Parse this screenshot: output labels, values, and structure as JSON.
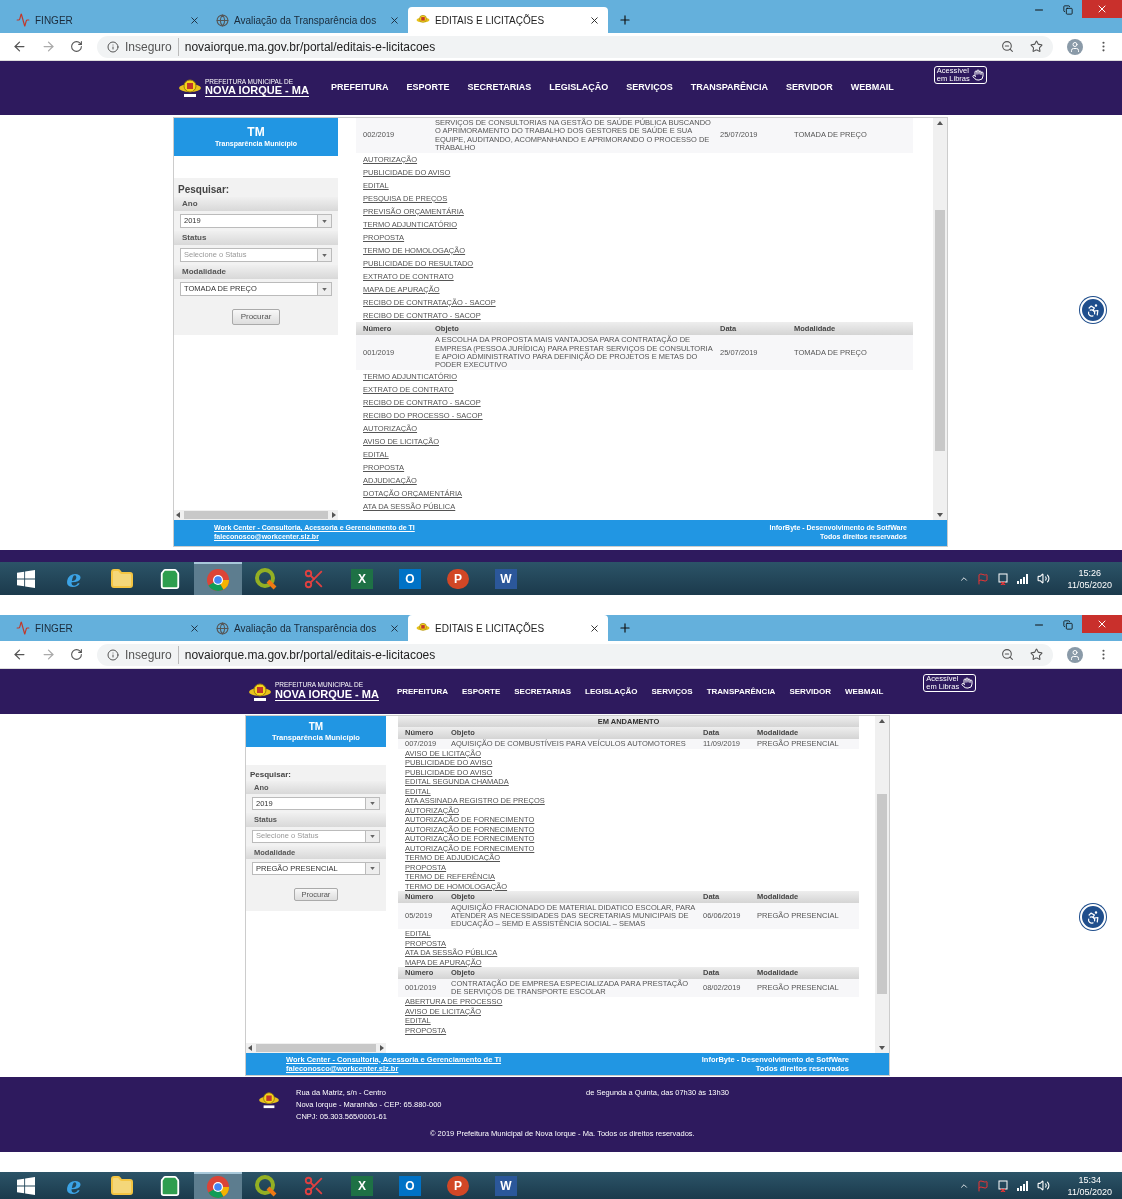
{
  "shots": [
    {
      "browser": {
        "tabs": [
          {
            "title": "FINGER",
            "kind": "finger",
            "selected": false
          },
          {
            "title": "Avaliação da Transparência dos",
            "kind": "globe",
            "selected": false
          },
          {
            "title": "EDITAIS E LICITAÇÕES",
            "kind": "crest",
            "selected": true
          }
        ],
        "security": "Inseguro",
        "url": "novaiorque.ma.gov.br/portal/editais-e-licitacoes"
      },
      "site_header": {
        "logo_small": "PREFEITURA MUNICIPAL DE",
        "logo_name": "NOVA IORQUE - MA",
        "nav": [
          "PREFEITURA",
          "ESPORTE",
          "SECRETARIAS",
          "LEGISLAÇÃO",
          "SERVIÇOS",
          "TRANSPARÊNCIA",
          "SERVIDOR",
          "WEBMAIL"
        ],
        "libras": [
          "Acessível",
          "em Libras"
        ]
      },
      "panel": {
        "brand_title": "TM",
        "brand_subtitle": "Transparência Município",
        "search_label": "Pesquisar:",
        "filters": [
          {
            "label": "Ano",
            "value": "2019"
          },
          {
            "label": "Status",
            "placeholder": "Selecione o Status"
          },
          {
            "label": "Modalidade",
            "value": "TOMADA DE PREÇO"
          }
        ],
        "button": "Procurar"
      },
      "list": {
        "groups": [
          {
            "numero": "002/2019",
            "objeto": "SERVIÇOS DE CONSULTORIAS NA GESTÃO DE SAÚDE PÚBLICA BUSCANDO O APRIMORAMENTO DO TRABALHO DOS GESTORES DE SAÚDE E SUA EQUIPE, AUDITANDO, ACOMPANHANDO E APRIMORANDO O PROCESSO DE TRABALHO",
            "data": "25/07/2019",
            "modalidade": "TOMADA DE PREÇO",
            "documents": [
              "AUTORIZAÇÃO",
              "PUBLICIDADE DO AVISO",
              "EDITAL",
              "PESQUISA DE PREÇOS",
              "PREVISÃO ORÇAMENTÁRIA",
              "TERMO ADJUNTICATÓRIO",
              "PROPOSTA",
              "TERMO DE HOMOLOGAÇÃO",
              "PUBLICIDADE DO RESULTADO",
              "EXTRATO DE CONTRATO",
              "MAPA DE APURAÇÃO",
              "RECIBO DE CONTRATAÇÃO - SACOP",
              "RECIBO DE CONTRATO - SACOP"
            ]
          },
          {
            "columns": [
              "Número",
              "Objeto",
              "Data",
              "Modalidade"
            ],
            "numero": "001/2019",
            "objeto": "A ESCOLHA DA PROPOSTA MAIS VANTAJOSA PARA CONTRATAÇÃO DE EMPRESA (PESSOA JURÍDICA) PARA PRESTAR SERVIÇOS DE CONSULTORIA E APOIO ADMINISTRATIVO PARA DEFINIÇÃO DE PROJETOS E METAS DO PODER EXECUTIVO",
            "data": "25/07/2019",
            "modalidade": "TOMADA DE PREÇO",
            "documents": [
              "TERMO ADJUNTICATÓRIO",
              "EXTRATO DE CONTRATO",
              "RECIBO DE CONTRATO - SACOP",
              "RECIBO DO PROCESSO - SACOP",
              "AUTORIZAÇÃO",
              "AVISO DE LICITAÇÃO",
              "EDITAL",
              "PROPOSTA",
              "ADJUDICAÇÃO",
              "DOTAÇÃO ORÇAMENTÁRIA",
              "ATA DA SESSÃO PÚBLICA"
            ]
          }
        ]
      },
      "frame_footer": {
        "links": [
          "Work Center - Consultoria, Acessoria e Gerenciamento de TI",
          "faleconosco@workcenter.slz.br"
        ],
        "credits": [
          "InforByte - Desenvolvimento de SotfWare",
          "Todos direitos reservados"
        ]
      },
      "taskbar": {
        "apps": [
          {
            "kind": "ie",
            "glyph": "e",
            "selected": false
          },
          {
            "kind": "folder",
            "selected": false
          },
          {
            "kind": "store",
            "selected": false
          },
          {
            "kind": "chrome",
            "selected": true
          },
          {
            "kind": "qgis",
            "selected": false
          },
          {
            "kind": "snip",
            "selected": false
          },
          {
            "kind": "excel",
            "glyph": "X",
            "selected": false
          },
          {
            "kind": "outlook",
            "glyph": "O",
            "selected": false
          },
          {
            "kind": "powerpoint",
            "glyph": "P",
            "selected": false
          },
          {
            "kind": "word",
            "glyph": "W",
            "selected": false
          }
        ],
        "time": "15:26",
        "date": "11/05/2020"
      }
    },
    {
      "browser": {
        "tabs": [
          {
            "title": "FINGER",
            "kind": "finger",
            "selected": false
          },
          {
            "title": "Avaliação da Transparência dos",
            "kind": "globe",
            "selected": false
          },
          {
            "title": "EDITAIS E LICITAÇÕES",
            "kind": "crest",
            "selected": true
          }
        ],
        "security": "Inseguro",
        "url": "novaiorque.ma.gov.br/portal/editais-e-licitacoes"
      },
      "site_header": {
        "logo_small": "PREFEITURA MUNICIPAL DE",
        "logo_name": "NOVA IORQUE - MA",
        "nav": [
          "PREFEITURA",
          "ESPORTE",
          "SECRETARIAS",
          "LEGISLAÇÃO",
          "SERVIÇOS",
          "TRANSPARÊNCIA",
          "SERVIDOR",
          "WEBMAIL"
        ],
        "libras": [
          "Acessível",
          "em Libras"
        ]
      },
      "panel": {
        "brand_title": "TM",
        "brand_subtitle": "Transparência Município",
        "search_label": "Pesquisar:",
        "filters": [
          {
            "label": "Ano",
            "value": "2019"
          },
          {
            "label": "Status",
            "placeholder": "Selecione o Status"
          },
          {
            "label": "Modalidade",
            "value": "PREGÃO PRESENCIAL"
          }
        ],
        "button": "Procurar"
      },
      "list": {
        "heading": "EM ANDAMENTO",
        "groups": [
          {
            "columns": [
              "Número",
              "Objeto",
              "Data",
              "Modalidade"
            ],
            "numero": "007/2019",
            "objeto": "AQUISIÇÃO DE COMBUSTÍVEIS PARA VEÍCULOS AUTOMOTORES",
            "data": "11/09/2019",
            "modalidade": "PREGÃO PRESENCIAL",
            "documents": [
              "AVISO DE LICITAÇÃO",
              "PUBLICIDADE DO AVISO",
              "PUBLICIDADE DO AVISO",
              "EDITAL SEGUNDA CHAMADA",
              "EDITAL",
              "ATA ASSINADA REGISTRO DE PREÇOS",
              "AUTORIZAÇÃO",
              "AUTORIZAÇÃO DE FORNECIMENTO",
              "AUTORIZAÇÃO DE FORNECIMENTO",
              "AUTORIZAÇÃO DE FORNECIMENTO",
              "AUTORIZAÇÃO DE FORNECIMENTO",
              "TERMO DE ADJUDICAÇÃO",
              "PROPOSTA",
              "TERMO DE REFERÊNCIA",
              "TERMO DE HOMOLOGAÇÃO"
            ]
          },
          {
            "columns": [
              "Número",
              "Objeto",
              "Data",
              "Modalidade"
            ],
            "numero": "05/2019",
            "objeto": "AQUISIÇÃO FRACIONADO DE MATERIAL DIDATICO ESCOLAR, PARA ATENDER AS NECESSIDADES DAS SECRETARIAS MUNICIPAIS DE EDUCAÇÃO – SEMD E ASSISTÊNCIA SOCIAL – SEMAS",
            "data": "06/06/2019",
            "modalidade": "PREGÃO PRESENCIAL",
            "documents": [
              "EDITAL",
              "PROPOSTA",
              "ATA DA SESSÃO PÚBLICA",
              "MAPA DE APURAÇÃO"
            ]
          },
          {
            "columns": [
              "Número",
              "Objeto",
              "Data",
              "Modalidade"
            ],
            "numero": "001/2019",
            "objeto": "CONTRATAÇÃO DE EMPRESA ESPECIALIZADA PARA PRESTAÇÃO DE SERVIÇOS DE TRANSPORTE ESCOLAR",
            "data": "08/02/2019",
            "modalidade": "PREGÃO PRESENCIAL",
            "documents": [
              "ABERTURA DE PROCESSO",
              "AVISO DE LICITAÇÃO",
              "EDITAL",
              "PROPOSTA"
            ]
          }
        ]
      },
      "frame_footer": {
        "links": [
          "Work Center - Consultoria, Acessoria e Gerenciamento de TI",
          "faleconosco@workcenter.slz.br"
        ],
        "credits": [
          "InforByte - Desenvolvimento de SotfWare",
          "Todos direitos reservados"
        ]
      },
      "site_footer": {
        "address": [
          "Rua da Matriz, s/n - Centro",
          "Nova Iorque - Maranhão - CEP: 65.880-000",
          "CNPJ: 05.303.565/0001-61"
        ],
        "hours": "de Segunda a Quinta, das 07h30 às 13h30",
        "copyright": "© 2019 Prefeitura Municipal de Nova Iorque - Ma. Todos os direitos reservados."
      },
      "taskbar": {
        "apps": [
          {
            "kind": "ie",
            "glyph": "e",
            "selected": false
          },
          {
            "kind": "folder",
            "selected": false
          },
          {
            "kind": "store",
            "selected": false
          },
          {
            "kind": "chrome",
            "selected": true
          },
          {
            "kind": "qgis",
            "selected": false
          },
          {
            "kind": "snip",
            "selected": false
          },
          {
            "kind": "excel",
            "glyph": "X",
            "selected": false
          },
          {
            "kind": "outlook",
            "glyph": "O",
            "selected": false
          },
          {
            "kind": "powerpoint",
            "glyph": "P",
            "selected": false
          },
          {
            "kind": "word",
            "glyph": "W",
            "selected": false
          }
        ],
        "time": "15:34",
        "date": "11/05/2020"
      }
    }
  ]
}
